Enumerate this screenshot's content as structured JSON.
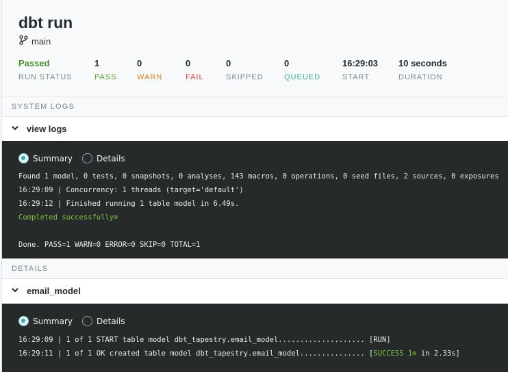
{
  "header": {
    "title": "dbt run",
    "branch": "main"
  },
  "stats": [
    {
      "value": "Passed",
      "label": "RUN STATUS"
    },
    {
      "value": "1",
      "label": "PASS"
    },
    {
      "value": "0",
      "label": "WARN"
    },
    {
      "value": "0",
      "label": "FAIL"
    },
    {
      "value": "0",
      "label": "SKIPPED"
    },
    {
      "value": "0",
      "label": "QUEUED"
    },
    {
      "value": "16:29:03",
      "label": "START"
    },
    {
      "value": "10 seconds",
      "label": "DURATION"
    }
  ],
  "system_logs": {
    "section_label": "SYSTEM LOGS",
    "group_label": "view logs",
    "radios": {
      "summary": "Summary",
      "details": "Details"
    },
    "lines": [
      "Found 1 model, 0 tests, 0 snapshots, 0 analyses, 143 macros, 0 operations, 0 seed files, 2 sources, 0 exposures",
      "16:29:09 | Concurrency: 1 threads (target='default')",
      "16:29:12 | Finished running 1 table model in 6.49s.",
      "Completed successfully⌧",
      "Done. PASS=1 WARN=0 ERROR=0 SKIP=0 TOTAL=1"
    ]
  },
  "details": {
    "section_label": "DETAILS",
    "group_label": "email_model",
    "radios": {
      "summary": "Summary",
      "details": "Details"
    },
    "lines": [
      "16:29:09 | 1 of 1 START table model dbt_tapestry.email_model.................... [RUN]",
      "16:29:11 | 1 of 1 OK created table model dbt_tapestry.email_model............... [",
      "SUCCESS 1⌧",
      " in 2.33s]"
    ]
  },
  "colors": {
    "passed": "#4b8f34",
    "warn": "#cf7e2a",
    "fail": "#c8403b",
    "queued": "#3fa8a8",
    "console_bg": "#262a2b"
  }
}
